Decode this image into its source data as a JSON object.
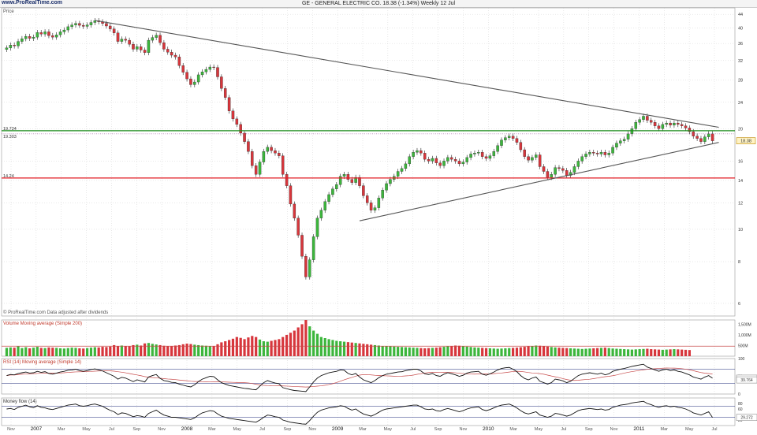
{
  "header": {
    "brand": "www.ProRealTime.com",
    "title": "GE - GENERAL ELECTRIC CO.    18.38  (-1.34%)    Weekly  12 Jul"
  },
  "price_panel": {
    "label": "Price",
    "footer": "© ProRealTime.com  Data adjusted after dividends",
    "hline_labels": [
      "19.724",
      "19.303",
      "14.24"
    ],
    "last_price_label": "18.38"
  },
  "volume_panel": {
    "label": "Volume  Moving average (Simple 200)"
  },
  "rsi_panel": {
    "label": "RSI (14)  Moving average (Simple 14)",
    "value_labels": [
      "44.573",
      "39.764"
    ]
  },
  "mfi_panel": {
    "label": "Money flow (14)",
    "value_labels": [
      "29.272"
    ]
  },
  "colors": {
    "up": "#3cb63c",
    "down": "#d7363c",
    "support": "#e21d25",
    "resistance": "#1a8a1a",
    "trend": "#555555",
    "grid": "#c7c7c7",
    "rsi_ma": "#c74a4a"
  },
  "chart_data": [
    {
      "type": "candlestick",
      "title": "GE - GENERAL ELECTRIC CO.",
      "x_tick_labels": [
        "Nov",
        "2007",
        "Mar",
        "May",
        "Jul",
        "Sep",
        "Nov",
        "2008",
        "Mar",
        "May",
        "Jul",
        "Sep",
        "Nov",
        "2009",
        "Mar",
        "May",
        "Jul",
        "Sep",
        "Nov",
        "2010",
        "Mar",
        "May",
        "Jul",
        "Sep",
        "Nov",
        "2011",
        "Mar",
        "May",
        "Jul"
      ],
      "y_scale": "log",
      "y_ticks": [
        6,
        8,
        10,
        12,
        14,
        16,
        20,
        24,
        28,
        32,
        36,
        40,
        44
      ],
      "ylim": [
        5.5,
        46
      ],
      "series_close": [
        34.9,
        35.6,
        35.4,
        36.5,
        37.2,
        37.8,
        37.3,
        37.6,
        38.8,
        38.4,
        39.0,
        38.0,
        37.6,
        38.2,
        39.0,
        39.5,
        40.4,
        40.9,
        41.3,
        40.8,
        40.5,
        40.9,
        41.6,
        42.1,
        41.8,
        41.3,
        40.6,
        39.8,
        38.7,
        36.5,
        37.1,
        36.8,
        35.8,
        34.6,
        35.2,
        34.4,
        33.8,
        36.8,
        37.5,
        38.1,
        36.2,
        34.6,
        33.9,
        33.2,
        32.8,
        30.9,
        29.5,
        28.2,
        27.1,
        27.6,
        29.0,
        29.6,
        30.1,
        30.6,
        30.5,
        28.6,
        26.4,
        24.8,
        22.6,
        21.4,
        20.6,
        19.4,
        18.3,
        17.1,
        15.5,
        14.6,
        15.9,
        17.1,
        17.6,
        17.2,
        16.9,
        16.6,
        14.6,
        13.5,
        11.9,
        10.8,
        9.6,
        8.3,
        7.2,
        8.1,
        9.5,
        10.8,
        11.4,
        12.1,
        12.7,
        13.2,
        13.6,
        14.4,
        14.6,
        14.1,
        13.8,
        14.3,
        13.5,
        12.6,
        12.0,
        11.4,
        11.6,
        12.4,
        13.1,
        13.7,
        14.1,
        14.4,
        14.9,
        15.2,
        15.7,
        16.5,
        17.0,
        17.2,
        16.9,
        16.2,
        16.0,
        16.3,
        15.8,
        15.5,
        16.0,
        16.4,
        16.2,
        16.0,
        15.7,
        15.9,
        16.4,
        16.8,
        16.9,
        17.0,
        16.5,
        16.3,
        16.6,
        17.1,
        17.8,
        18.5,
        18.8,
        19.0,
        18.7,
        18.2,
        17.3,
        16.5,
        16.1,
        16.4,
        16.7,
        15.4,
        14.9,
        14.3,
        14.6,
        15.3,
        15.2,
        15.0,
        14.5,
        14.8,
        15.4,
        16.0,
        16.5,
        16.8,
        17.0,
        16.9,
        16.8,
        17.0,
        16.7,
        16.9,
        17.6,
        18.1,
        18.4,
        18.6,
        19.3,
        20.0,
        20.9,
        21.3,
        21.8,
        21.2,
        20.9,
        20.4,
        20.0,
        20.6,
        20.8,
        20.5,
        20.8,
        20.6,
        20.4,
        20.1,
        19.6,
        19.0,
        18.7,
        18.3,
        18.9,
        19.3,
        18.4
      ],
      "horizontal_lines": [
        19.724,
        19.303,
        14.24
      ],
      "trendlines": [
        {
          "name": "resistance",
          "from": [
            "Sep 2007",
            42.2
          ],
          "to": [
            "Jul 2011",
            20.2
          ]
        },
        {
          "name": "support",
          "from": [
            "Jul 2009",
            10.6
          ],
          "to": [
            "Jul 2011",
            18.2
          ]
        }
      ]
    },
    {
      "type": "bar",
      "title": "Volume",
      "y_ticks": [
        "500M",
        "1,000M",
        "1,500M"
      ],
      "ylim": [
        0,
        1700
      ],
      "values": [
        390,
        410,
        400,
        460,
        380,
        420,
        370,
        400,
        440,
        390,
        380,
        410,
        400,
        390,
        370,
        360,
        380,
        400,
        390,
        370,
        360,
        380,
        400,
        420,
        410,
        440,
        430,
        450,
        520,
        480,
        500,
        470,
        460,
        520,
        540,
        500,
        600,
        620,
        580,
        550,
        520,
        490,
        480,
        470,
        500,
        520,
        560,
        590,
        570,
        540,
        520,
        500,
        490,
        470,
        480,
        560,
        650,
        700,
        760,
        820,
        900,
        860,
        800,
        880,
        950,
        900,
        780,
        700,
        680,
        720,
        760,
        800,
        900,
        1000,
        1100,
        1200,
        1350,
        1500,
        1700,
        1400,
        1200,
        1050,
        900,
        850,
        800,
        760,
        720,
        700,
        680,
        660,
        640,
        620,
        600,
        580,
        560,
        540,
        520,
        500,
        480,
        470,
        460,
        450,
        440,
        430,
        420,
        410,
        400,
        390,
        380,
        370,
        380,
        390,
        400,
        420,
        440,
        460,
        480,
        500,
        490,
        470,
        450,
        430,
        410,
        400,
        390,
        380,
        370,
        360,
        350,
        360,
        370,
        380,
        390,
        400,
        420,
        440,
        460,
        480,
        500,
        490,
        470,
        450,
        430,
        410,
        400,
        390,
        380,
        370,
        360,
        350,
        340,
        350,
        360,
        370,
        380,
        390,
        400,
        380,
        360,
        350,
        340,
        330,
        320,
        310,
        320,
        330,
        340,
        350,
        330,
        320,
        310,
        300,
        310,
        320,
        330,
        320,
        310,
        300,
        290
      ],
      "ma_value": 470
    },
    {
      "type": "line",
      "title": "RSI (14)",
      "y_ticks": [
        0,
        50,
        100
      ],
      "ylim": [
        0,
        100
      ],
      "values": [
        52,
        55,
        54,
        58,
        60,
        62,
        59,
        60,
        64,
        61,
        63,
        58,
        56,
        59,
        62,
        64,
        67,
        68,
        70,
        66,
        64,
        66,
        69,
        71,
        68,
        65,
        60,
        55,
        50,
        42,
        47,
        45,
        40,
        35,
        40,
        37,
        34,
        48,
        52,
        55,
        44,
        38,
        36,
        33,
        32,
        28,
        25,
        22,
        20,
        26,
        35,
        42,
        46,
        50,
        49,
        40,
        32,
        28,
        24,
        22,
        20,
        18,
        16,
        15,
        13,
        12,
        22,
        32,
        38,
        34,
        31,
        29,
        18,
        15,
        12,
        10,
        9,
        8,
        7,
        20,
        34,
        45,
        52,
        56,
        60,
        62,
        64,
        68,
        67,
        58,
        54,
        58,
        48,
        40,
        36,
        32,
        38,
        46,
        52,
        56,
        58,
        60,
        62,
        63,
        66,
        68,
        70,
        70,
        65,
        57,
        55,
        58,
        52,
        50,
        56,
        60,
        57,
        54,
        50,
        53,
        59,
        62,
        63,
        64,
        56,
        53,
        57,
        62,
        68,
        72,
        74,
        75,
        70,
        63,
        52,
        44,
        40,
        45,
        48,
        36,
        32,
        28,
        32,
        42,
        40,
        37,
        32,
        36,
        44,
        52,
        56,
        58,
        60,
        58,
        56,
        59,
        54,
        57,
        64,
        67,
        70,
        72,
        75,
        78,
        80,
        82,
        84,
        76,
        72,
        68,
        64,
        68,
        70,
        66,
        68,
        64,
        62,
        58,
        54,
        48,
        45,
        42,
        48,
        52,
        44.6
      ],
      "ma_values_label": "39.764"
    },
    {
      "type": "line",
      "title": "Money flow (14)",
      "y_ticks": [
        20,
        60,
        80
      ],
      "ylim": [
        0,
        100
      ],
      "values": [
        60,
        62,
        58,
        66,
        70,
        74,
        68,
        65,
        72,
        66,
        64,
        60,
        58,
        62,
        66,
        70,
        74,
        76,
        78,
        72,
        70,
        72,
        76,
        78,
        74,
        70,
        62,
        55,
        50,
        40,
        46,
        44,
        38,
        32,
        36,
        34,
        30,
        44,
        50,
        56,
        46,
        38,
        34,
        30,
        30,
        28,
        26,
        24,
        22,
        28,
        38,
        46,
        50,
        54,
        52,
        42,
        34,
        30,
        26,
        24,
        22,
        20,
        18,
        16,
        14,
        12,
        20,
        30,
        38,
        36,
        32,
        30,
        20,
        16,
        12,
        10,
        8,
        6,
        5,
        18,
        34,
        48,
        56,
        60,
        64,
        66,
        68,
        72,
        70,
        62,
        56,
        60,
        50,
        42,
        38,
        34,
        40,
        48,
        56,
        60,
        62,
        64,
        66,
        68,
        70,
        72,
        74,
        74,
        68,
        60,
        58,
        60,
        54,
        52,
        58,
        62,
        58,
        54,
        50,
        54,
        60,
        64,
        66,
        68,
        58,
        54,
        58,
        64,
        70,
        74,
        76,
        78,
        72,
        64,
        54,
        46,
        42,
        46,
        50,
        38,
        34,
        30,
        34,
        44,
        42,
        38,
        34,
        38,
        46,
        54,
        58,
        60,
        62,
        60,
        58,
        60,
        56,
        58,
        66,
        70,
        74,
        76,
        78,
        82,
        84,
        86,
        88,
        80,
        76,
        70,
        66,
        70,
        72,
        68,
        70,
        66,
        64,
        60,
        54,
        46,
        42,
        38,
        44,
        50,
        29.3
      ]
    }
  ]
}
